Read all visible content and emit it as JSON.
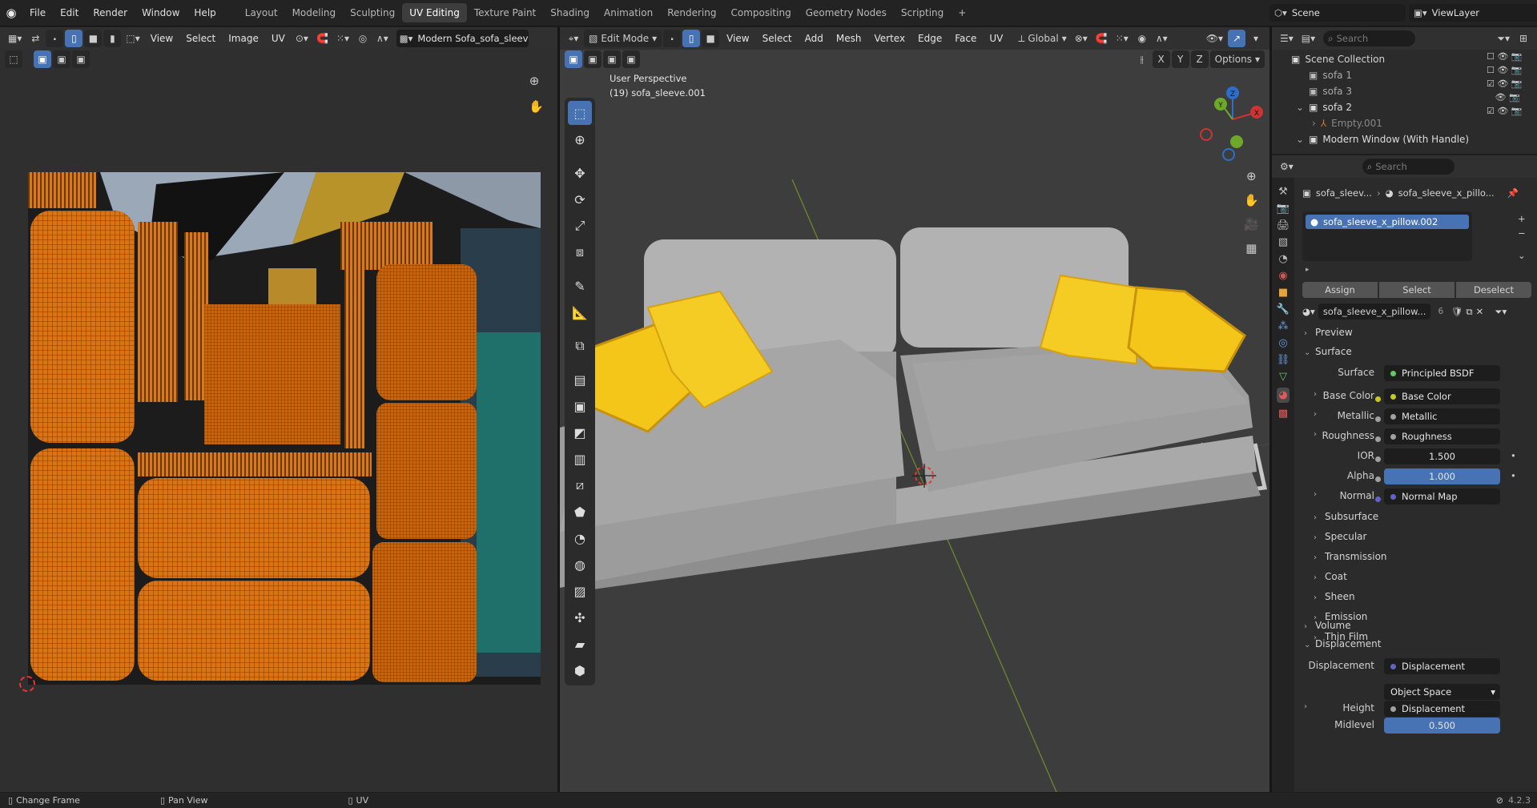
{
  "topbar": {
    "menus": [
      "File",
      "Edit",
      "Render",
      "Window",
      "Help"
    ],
    "workspaces": [
      "Layout",
      "Modeling",
      "Sculpting",
      "UV Editing",
      "Texture Paint",
      "Shading",
      "Animation",
      "Rendering",
      "Compositing",
      "Geometry Nodes",
      "Scripting"
    ],
    "active_workspace": "UV Editing",
    "add_tab": "+",
    "scene": "Scene",
    "view_layer": "ViewLayer"
  },
  "uv_editor": {
    "menus": [
      "View",
      "Select",
      "Image",
      "UV"
    ],
    "image_name": "Modern Sofa_sofa_sleev"
  },
  "viewport": {
    "mode": "Edit Mode",
    "menus": [
      "View",
      "Select",
      "Add",
      "Mesh",
      "Vertex",
      "Edge",
      "Face",
      "UV"
    ],
    "orientation": "Global",
    "overlay_title": "User Perspective",
    "overlay_object": "(19) sofa_sleeve.001",
    "axes": [
      "X",
      "Y",
      "Z"
    ],
    "options": "Options",
    "gizmo": {
      "z": "Z",
      "y": "Y",
      "x": "X"
    }
  },
  "outliner": {
    "search_placeholder": "Search",
    "collection": "Scene Collection",
    "items": [
      {
        "label": "sofa 1",
        "dim": false
      },
      {
        "label": "sofa 3",
        "dim": false
      },
      {
        "label": "sofa 2",
        "dim": false
      },
      {
        "label": "Empty.001",
        "dim": true
      },
      {
        "label": "Modern Window (With Handle)",
        "dim": false
      },
      {
        "label": "Modern Window (With Handle)",
        "dim": true
      }
    ]
  },
  "properties": {
    "search_placeholder": "Search",
    "breadcrumb_object": "sofa_sleev...",
    "breadcrumb_material": "sofa_sleeve_x_pillo...",
    "slot": "sofa_sleeve_x_pillow.002",
    "buttons": {
      "assign": "Assign",
      "select": "Select",
      "deselect": "Deselect"
    },
    "material_name": "sofa_sleeve_x_pillow...",
    "user_count": "6",
    "panels": {
      "preview": "Preview",
      "surface": "Surface",
      "volume": "Volume",
      "displacement": "Displacement"
    },
    "surface": {
      "label": "Surface",
      "value": "Principled BSDF",
      "dot": "#63c763"
    },
    "inputs": [
      {
        "label": "Base Color",
        "value": "Base Color",
        "dot": "#c7c729",
        "kind": "link"
      },
      {
        "label": "Metallic",
        "value": "Metallic",
        "dot": "#a1a1a1",
        "kind": "link"
      },
      {
        "label": "Roughness",
        "value": "Roughness",
        "dot": "#a1a1a1",
        "kind": "link"
      },
      {
        "label": "IOR",
        "value": "1.500",
        "dot": "#a1a1a1",
        "kind": "num"
      },
      {
        "label": "Alpha",
        "value": "1.000",
        "dot": "#a1a1a1",
        "kind": "slider"
      },
      {
        "label": "Normal",
        "value": "Normal Map",
        "dot": "#6363c7",
        "kind": "link"
      }
    ],
    "subpanels": [
      "Subsurface",
      "Specular",
      "Transmission",
      "Coat",
      "Sheen",
      "Emission",
      "Thin Film"
    ],
    "disp": {
      "label": "Displacement",
      "value": "Displacement",
      "dot": "#6363c7",
      "space": "Object Space",
      "height_label": "Height",
      "height_value": "Displacement",
      "midlevel_label": "Midlevel",
      "midlevel_value": "0.500"
    }
  },
  "status": {
    "left": "Change Frame",
    "middle": "Pan View",
    "right": "UV",
    "version": "4.2.3"
  },
  "colors": {
    "accent": "#4772b3",
    "uv_mesh": "#e07a17",
    "pillow": "#f5c61a"
  }
}
